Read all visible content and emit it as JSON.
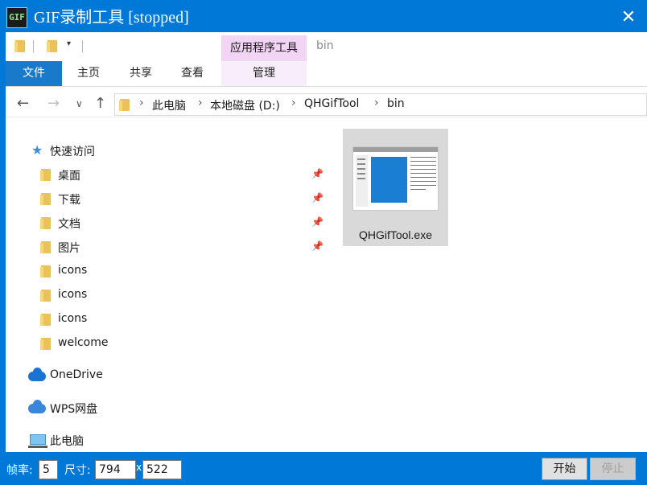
{
  "app": {
    "icon_text": "GIF",
    "title": "GIF录制工具 [stopped]",
    "close_glyph": "✕"
  },
  "ribbon": {
    "context_group": "应用程序工具",
    "top_crumb": "bin",
    "tabs": [
      {
        "label": "文件"
      },
      {
        "label": "主页"
      },
      {
        "label": "共享"
      },
      {
        "label": "查看"
      },
      {
        "label": "管理"
      }
    ],
    "qat_dropdown": "▾"
  },
  "address": {
    "back": "←",
    "forward": "→",
    "recent": "∨",
    "up": "↑",
    "separator": "›",
    "crumbs": [
      "此电脑",
      "本地磁盘 (D:)",
      "QHGifTool",
      "bin"
    ]
  },
  "nav_pane": {
    "pin_glyph": "📌",
    "star_glyph": "★",
    "quick_access": "快速访问",
    "pinned": [
      "桌面",
      "下载",
      "文档",
      "图片"
    ],
    "folders": [
      "icons",
      "icons",
      "icons",
      "welcome"
    ],
    "onedrive": "OneDrive",
    "wps": "WPS网盘",
    "this_pc": "此电脑"
  },
  "files": [
    {
      "name": "QHGifTool.exe",
      "icon": "exe-app-icon"
    }
  ],
  "controls": {
    "fps_label": "帧率:",
    "fps_value": "5",
    "size_label": "尺寸:",
    "width_value": "794",
    "times": "x",
    "height_value": "522",
    "start_label": "开始",
    "stop_label": "停止"
  },
  "colors": {
    "accent": "#0078d7",
    "file_tab": "#1979ca",
    "context_tab": "#f2d4f5",
    "selection": "#d9d9d9"
  }
}
